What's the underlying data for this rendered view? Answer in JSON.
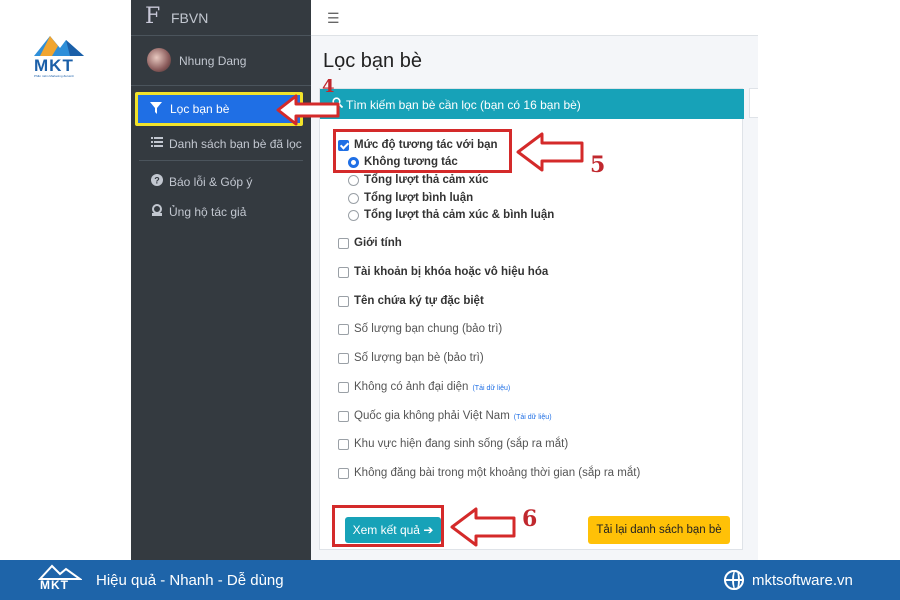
{
  "logo": {
    "text": "MKT",
    "tagline": "Phần mềm Marketing đa kênh"
  },
  "sidebar": {
    "brand_letter": "F",
    "brand_name": "FBVN",
    "user_name": "Nhung Dang",
    "items": [
      {
        "label": "Lọc bạn bè",
        "icon": "filter-icon",
        "active": true
      },
      {
        "label": "Danh sách bạn bè đã lọc",
        "icon": "list-icon",
        "active": false
      },
      {
        "label": "Báo lỗi & Góp ý",
        "icon": "question-icon",
        "active": false
      },
      {
        "label": "Ủng hộ tác giả",
        "icon": "support-icon",
        "active": false
      }
    ]
  },
  "topbar": {
    "menu_icon": "hamburger-icon"
  },
  "page": {
    "title": "Lọc bạn bè"
  },
  "card": {
    "header": "Tìm kiếm bạn bè cần lọc (bạn có 16 bạn bè)",
    "interaction": {
      "label": "Mức độ tương tác với bạn",
      "checked": true,
      "radios": [
        {
          "label": "Không tương tác",
          "checked": true
        },
        {
          "label": "Tổng lượt thả cảm xúc",
          "checked": false
        },
        {
          "label": "Tổng lượt bình luận",
          "checked": false
        },
        {
          "label": "Tổng lượt thả cảm xúc & bình luận",
          "checked": false
        }
      ]
    },
    "options": [
      {
        "label": "Giới tính",
        "note": ""
      },
      {
        "label": "Tài khoản bị khóa hoặc vô hiệu hóa",
        "note": ""
      },
      {
        "label": "Tên chứa ký tự đặc biệt",
        "note": ""
      },
      {
        "label": "Số lượng bạn chung (bảo trì)",
        "note": ""
      },
      {
        "label": "Số lượng bạn bè (bảo trì)",
        "note": ""
      },
      {
        "label": "Không có ảnh đại diện",
        "note": "(Tải dữ liệu)"
      },
      {
        "label": "Quốc gia không phải Việt Nam",
        "note": "(Tải dữ liệu)"
      },
      {
        "label": "Khu vực hiện đang sinh sống (sắp ra mắt)",
        "note": ""
      },
      {
        "label": "Không đăng bài trong một khoảng thời gian (sắp ra mắt)",
        "note": ""
      }
    ],
    "view_button": "Xem kết quả ➔",
    "reload_button": "Tải lại danh sách bạn bè"
  },
  "annotations": {
    "step4": "4",
    "step5": "5",
    "step6": "6"
  },
  "colors": {
    "sidebar": "#343a40",
    "header": "#17a2b8",
    "active": "#1f6fe5",
    "highlight": "#f2e32a",
    "annotation": "#d42a2a",
    "reload": "#ffc107",
    "footer": "#1e64a9"
  },
  "footer": {
    "logo_text": "MKT",
    "slogan": "Hiệu quả - Nhanh - Dễ dùng",
    "website": "mktsoftware.vn"
  }
}
